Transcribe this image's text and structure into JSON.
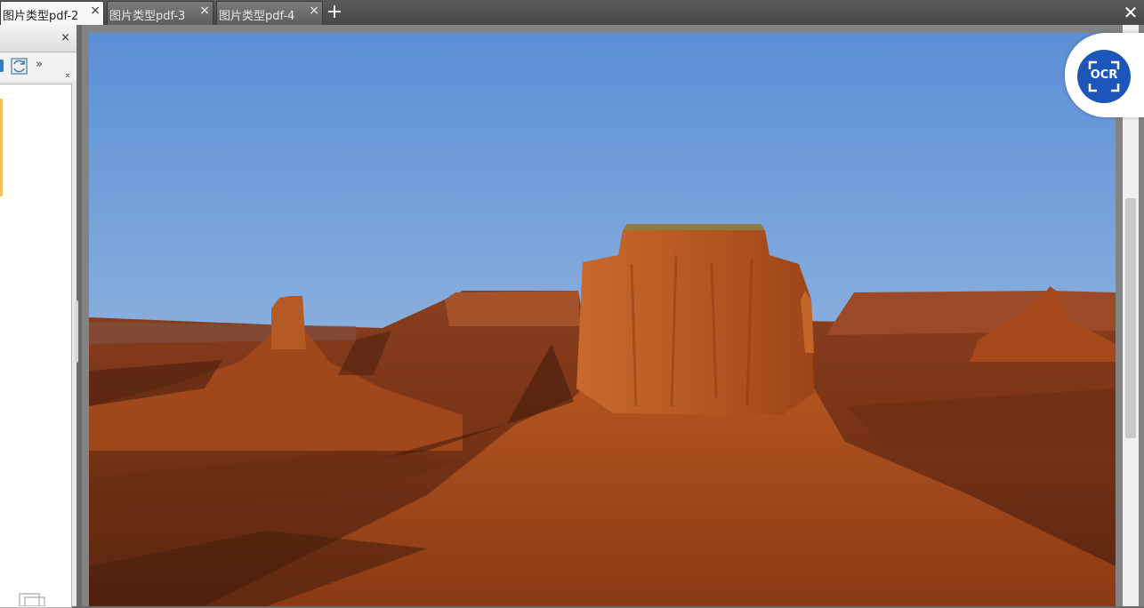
{
  "tabs": [
    {
      "label": "图片类型pdf-2",
      "active": true
    },
    {
      "label": "图片类型pdf-3",
      "active": false
    },
    {
      "label": "图片类型pdf-4",
      "active": false
    }
  ],
  "tab_close_glyph": "×",
  "new_tab_glyph": "+",
  "window_close_glyph": "✕",
  "sidebar": {
    "close_glyph": "×",
    "tools": {
      "rotate_icon": "rotate-360-icon",
      "more_icon": "double-chevron-down-icon",
      "collapse_icon": "collapse-up-icon"
    },
    "more_glyph": "»",
    "collapse_glyph": "⌅"
  },
  "ocr_button": {
    "label": "OCR",
    "color": "#1d55b8"
  },
  "document": {
    "content": "desert-butte-photo"
  },
  "colors": {
    "tab_bar": "#4e4e4e",
    "viewer_bg": "#838383",
    "active_tab": "#f7f7f7"
  }
}
